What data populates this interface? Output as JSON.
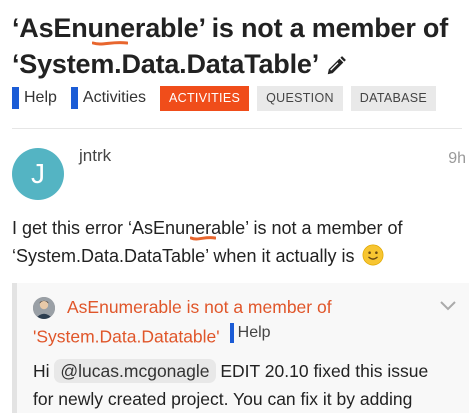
{
  "topic": {
    "title_part1": "‘AsEnunerable’ is not a member of",
    "title_part2": "‘System.Data.DataTable’"
  },
  "category": {
    "label": "Help",
    "color": "#1b5cd6"
  },
  "subcategory": {
    "label": "Activities"
  },
  "tags": [
    "ACTIVITIES",
    "QUESTION",
    "DATABASE"
  ],
  "post": {
    "avatar_letter": "J",
    "avatar_color": "#54b4c3",
    "username": "jntrk",
    "time": "9h",
    "line1": "I get this error ‘AsEnunerable’ is not a member of",
    "line2": "‘System.Data.DataTable’ when it actually is"
  },
  "quote": {
    "title_line1": "AsEnumerable is not a member of",
    "title_line2": "'System.Data.Datatable'",
    "category": "Help",
    "text_prefix": "Hi",
    "mention": "@lucas.mcgonagle",
    "text_suffix": "EDIT 20.10 fixed this issue",
    "text_line2": "for newly created project. You can fix it by adding"
  },
  "colors": {
    "accent": "#f04d1a",
    "quote_title": "#e0562a",
    "misspelling": "#e8662e"
  }
}
